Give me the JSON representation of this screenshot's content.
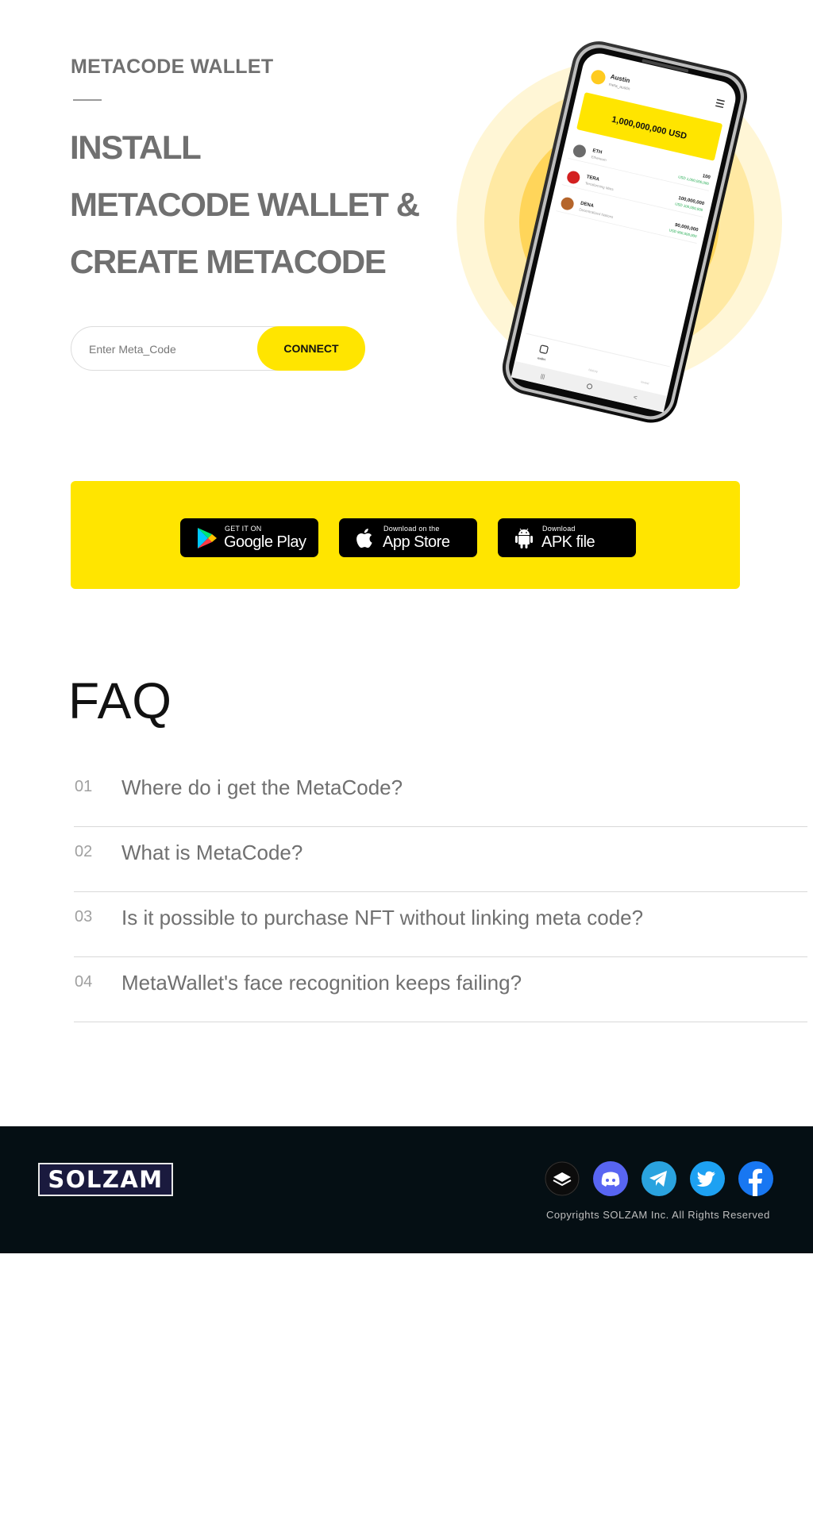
{
  "hero": {
    "eyebrow": "METACODE WALLET",
    "headline": [
      "INSTALL",
      "METACODE WALLET &",
      "CREATE METACODE"
    ],
    "code_input": {
      "placeholder": "Enter Meta_Code",
      "value": ""
    },
    "connect_label": "CONNECT"
  },
  "phone_preview": {
    "user_name": "Austin",
    "user_handle": "meta_austin",
    "balance": "1,000,000,000 USD",
    "assets": [
      {
        "symbol": "ETH",
        "name": "Ethereum",
        "amount": "100",
        "usd": "USD 1,000,000,000",
        "color": "#6b6b6b"
      },
      {
        "symbol": "TERA",
        "name": "Terraforming Mars",
        "amount": "100,000,000",
        "usd": "USD 100,000,000",
        "color": "#d32020"
      },
      {
        "symbol": "DENA",
        "name": "Decentralized Nations",
        "amount": "90,000,000",
        "usd": "USD 900,000,000",
        "color": "#b5652b"
      }
    ],
    "nav": [
      "wallet",
      "history",
      "invest"
    ]
  },
  "stores": [
    {
      "small": "GET IT ON",
      "big": "Google Play",
      "icon": "google-play-icon"
    },
    {
      "small": "Download on the",
      "big": "App Store",
      "icon": "apple-icon"
    },
    {
      "small": "Download",
      "big": "APK file",
      "icon": "android-icon"
    }
  ],
  "faq": {
    "title": "FAQ",
    "items": [
      {
        "num": "01",
        "question": "Where do i get the MetaCode?"
      },
      {
        "num": "02",
        "question": "What is MetaCode?"
      },
      {
        "num": "03",
        "question": "Is it possible to purchase NFT without linking meta code?"
      },
      {
        "num": "04",
        "question": "MetaWallet's face recognition keeps failing?"
      }
    ]
  },
  "footer": {
    "logo_text": "SOLZAM",
    "social": [
      {
        "name": "gitbook-icon",
        "color": "#0c0c0c"
      },
      {
        "name": "discord-icon",
        "color": "#5865f2"
      },
      {
        "name": "telegram-icon",
        "color": "#2aa3df"
      },
      {
        "name": "twitter-icon",
        "color": "#1da1f2"
      },
      {
        "name": "facebook-icon",
        "color": "#1877f2"
      }
    ],
    "copyright": "Copyrights SOLZAM Inc. All Rights Reserved"
  },
  "colors": {
    "accent": "#ffe500",
    "text": "#707070",
    "footer_bg": "#050f14"
  }
}
